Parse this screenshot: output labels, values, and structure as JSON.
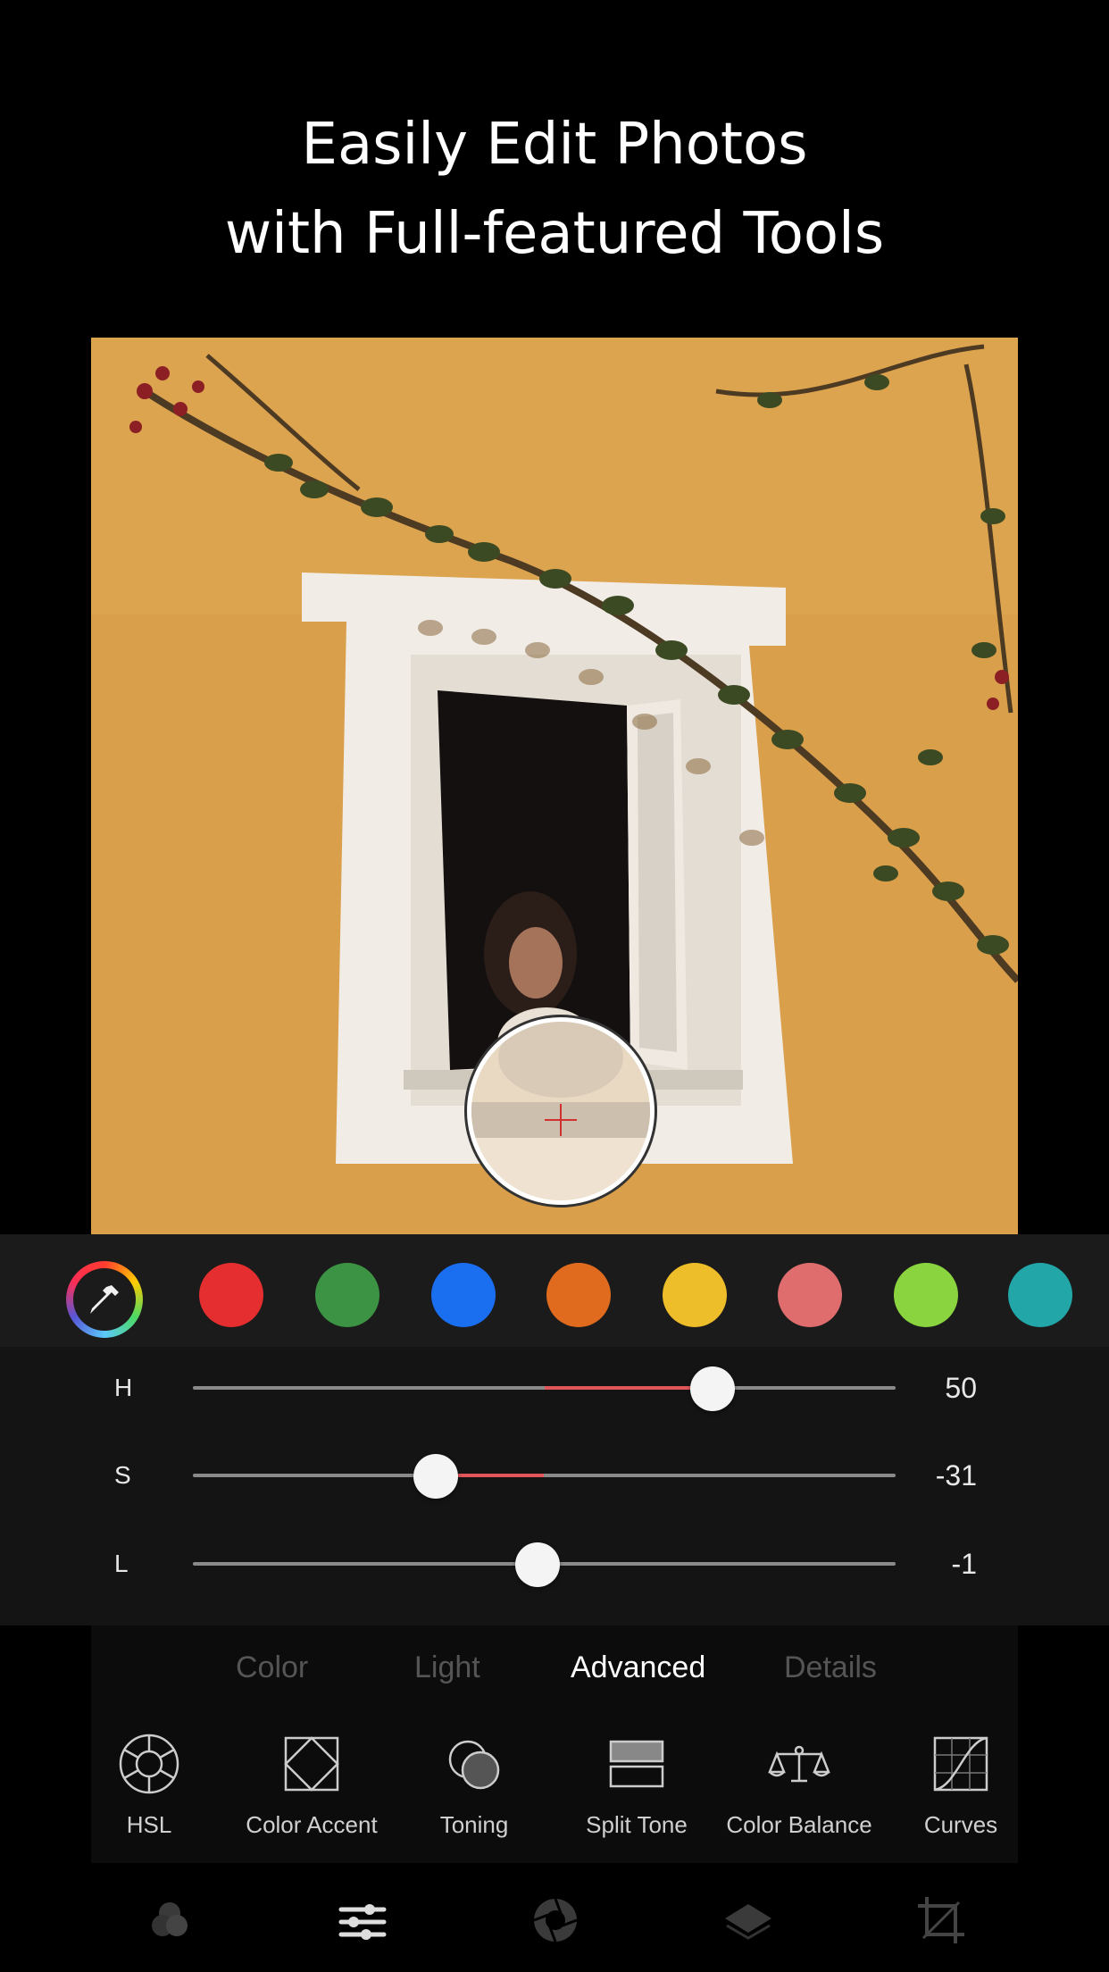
{
  "headline": {
    "line1": "Easily Edit Photos",
    "line2": "with Full-featured Tools"
  },
  "swatches": [
    {
      "name": "red",
      "color": "#e42e2f"
    },
    {
      "name": "green",
      "color": "#3b9343"
    },
    {
      "name": "blue",
      "color": "#1a6ef0"
    },
    {
      "name": "orange",
      "color": "#e06b1e"
    },
    {
      "name": "yellow",
      "color": "#eebd2a"
    },
    {
      "name": "pink",
      "color": "#df6d6e"
    },
    {
      "name": "lime",
      "color": "#8ad43f"
    },
    {
      "name": "teal",
      "color": "#22a6a8"
    }
  ],
  "sliders": {
    "h": {
      "label": "H",
      "value": "50",
      "fraction": 0.74
    },
    "s": {
      "label": "S",
      "value": "-31",
      "fraction": 0.345
    },
    "l": {
      "label": "L",
      "value": "-1",
      "fraction": 0.49
    }
  },
  "tabs": [
    "Color",
    "Light",
    "Advanced",
    "Details"
  ],
  "active_tab": "Advanced",
  "tools": [
    "HSL",
    "Color Accent",
    "Toning",
    "Split Tone",
    "Color Balance",
    "Curves"
  ],
  "bottom_nav": [
    "filters-icon",
    "adjust-sliders-icon",
    "aperture-icon",
    "layers-icon",
    "crop-icon"
  ],
  "colors": {
    "accent_fill": "#e0565b",
    "photo_wall": "#dca24d"
  }
}
